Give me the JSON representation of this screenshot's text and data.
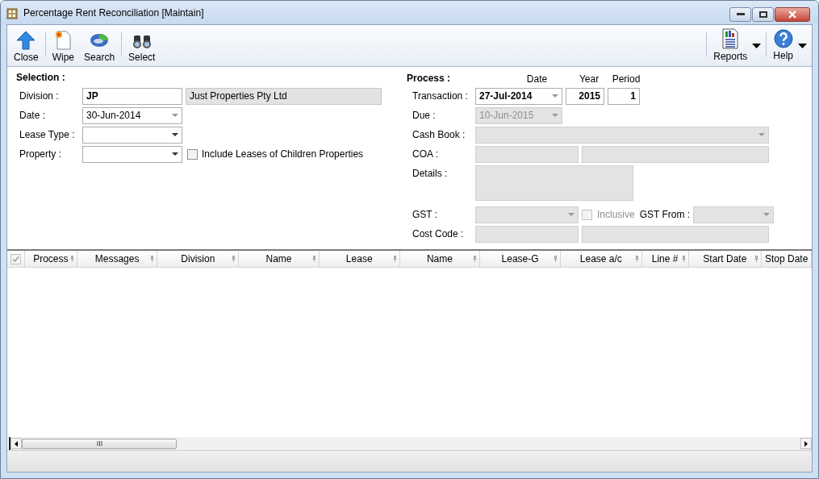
{
  "window": {
    "title": "Percentage Rent Reconciliation [Maintain]"
  },
  "toolbar": {
    "left": [
      {
        "label": "Close",
        "kind": "close"
      },
      {
        "label": "Wipe",
        "kind": "wipe"
      },
      {
        "label": "Search",
        "kind": "search"
      },
      {
        "label": "Select",
        "kind": "select"
      }
    ],
    "right": [
      {
        "label": "Reports",
        "kind": "reports",
        "menu": true
      },
      {
        "label": "Help",
        "kind": "help",
        "menu": true
      }
    ]
  },
  "selection": {
    "heading": "Selection :",
    "division": {
      "label": "Division :",
      "code": "JP",
      "name": "Just Properties Pty Ltd"
    },
    "date": {
      "label": "Date :",
      "value": "30-Jun-2014"
    },
    "lease_type": {
      "label": "Lease Type :"
    },
    "property": {
      "label": "Property :"
    },
    "include_children": {
      "label": "Include Leases of Children Properties",
      "checked": false
    }
  },
  "process": {
    "heading": "Process :",
    "columns": [
      "Date",
      "Year",
      "Period"
    ],
    "transaction": {
      "label": "Transaction :",
      "date": "27-Jul-2014",
      "year": "2015",
      "period": "1"
    },
    "due": {
      "label": "Due :",
      "value": "10-Jun-2015",
      "disabled": true
    },
    "cash_book": {
      "label": "Cash Book :",
      "disabled": true
    },
    "coa": {
      "label": "COA :",
      "disabled": true
    },
    "details": {
      "label": "Details :",
      "disabled": true
    },
    "gst": {
      "label": "GST :",
      "disabled": true
    },
    "inclusive": {
      "label": "Inclusive",
      "checked": false,
      "disabled": true
    },
    "gst_from": {
      "label": "GST From :"
    },
    "cost_code": {
      "label": "Cost Code :",
      "disabled": true
    }
  },
  "grid": {
    "select_all": {
      "checked": true
    },
    "columns": [
      {
        "label": "Process",
        "filter": true
      },
      {
        "label": "Messages",
        "filter": true
      },
      {
        "label": "Division",
        "filter": true
      },
      {
        "label": "Name",
        "filter": true
      },
      {
        "label": "Lease",
        "filter": true
      },
      {
        "label": "Name",
        "filter": true
      },
      {
        "label": "Lease-G",
        "filter": true
      },
      {
        "label": "Lease a/c",
        "filter": true
      },
      {
        "label": "Line #",
        "filter": true
      },
      {
        "label": "Start Date",
        "filter": true
      },
      {
        "label": "Stop Date",
        "filter": false
      }
    ]
  }
}
